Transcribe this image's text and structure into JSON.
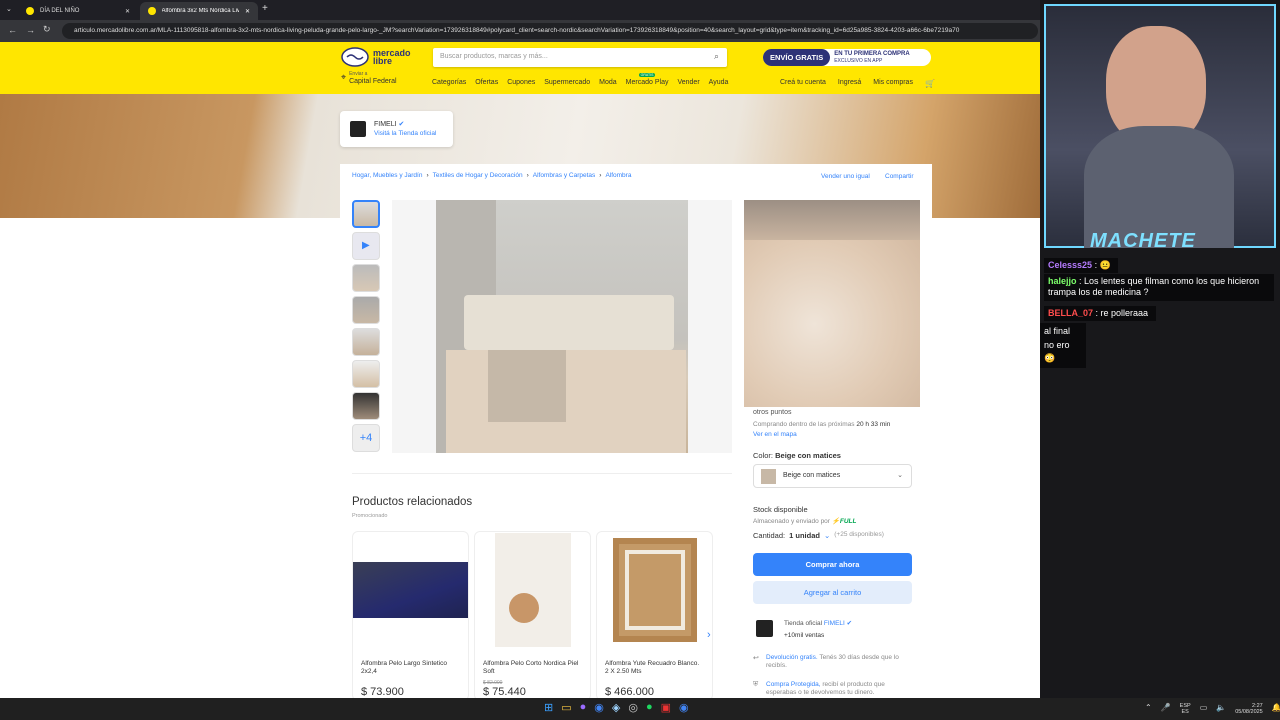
{
  "browser": {
    "tabs": [
      {
        "label": "DÍA DEL NIÑO"
      },
      {
        "label": "Alfombra 3x2 Mts Nórdica Livi"
      }
    ],
    "url": "articulo.mercadolibre.com.ar/MLA-1113095818-alfombra-3x2-mts-nordica-living-peluda-grande-pelo-largo-_JM?searchVariation=173926318849#polycard_client=search-nordic&searchVariation=173926318849&position=40&search_layout=grid&type=item&tracking_id=6d25a985-3824-4203-a66c-6be7219a70"
  },
  "header": {
    "logo_text": "mercado libre",
    "search_placeholder": "Buscar productos, marcas y más...",
    "promo_main": "ENVÍO GRATIS",
    "promo_sub_1": "EN TU PRIMERA COMPRA",
    "promo_sub_2": "EXCLUSIVO EN APP",
    "location_label": "Enviar a",
    "location_value": "Capital Federal",
    "nav": [
      "Categorías",
      "Ofertas",
      "Cupones",
      "Supermercado",
      "Moda",
      "Mercado Play",
      "Vender",
      "Ayuda"
    ],
    "nav_badge": "GRATIS",
    "account": [
      "Creá tu cuenta",
      "Ingresá",
      "Mis compras"
    ]
  },
  "store": {
    "name": "FIMELI",
    "link": "Visitá la Tienda oficial"
  },
  "breadcrumb": [
    "Hogar, Muebles y Jardín",
    "Textiles de Hogar y Decoración",
    "Alfombras y Carpetas",
    "Alfombra"
  ],
  "actions": {
    "sell": "Vender uno igual",
    "share": "Compartir"
  },
  "gallery": {
    "more": "+4"
  },
  "buy": {
    "shipping_tail": "otros puntos",
    "shipping_time": "Comprando dentro de las próximas",
    "shipping_time_bold": "20 h 33 min",
    "map_link": "Ver en el mapa",
    "color_label": "Color:",
    "color_value": "Beige con matices",
    "stock": "Stock disponible",
    "fulfilled": "Almacenado y enviado por",
    "full": "FULL",
    "qty_label": "Cantidad:",
    "qty_value": "1 unidad",
    "qty_available": "(+25 disponibles)",
    "buy_now": "Comprar ahora",
    "add_cart": "Agregar al carrito",
    "seller_prefix": "Tienda oficial",
    "seller_name": "FIMELI",
    "seller_sales": "+10mil ventas",
    "return_link": "Devolución gratis.",
    "return_text": "Tenés 30 días desde que lo recibís.",
    "protect_link": "Compra Protegida,",
    "protect_text": "recibí el producto que esperabas o te devolvemos tu dinero."
  },
  "related": {
    "title": "Productos relacionados",
    "sub": "Promocionado",
    "items": [
      {
        "title": "Alfombra Pelo Largo Sintetico 2x2,4",
        "old": "",
        "price": "$ 73.900"
      },
      {
        "title": "Alfombra Pelo Corto Nordica Piel Soft",
        "old": "$ 82.000",
        "price": "$ 75.440"
      },
      {
        "title": "Alfombra Yute Recuadro Blanco. 2 X 2.50 Mts",
        "old": "",
        "price": "$ 466.000"
      }
    ]
  },
  "stream": {
    "title": "MACHETE",
    "chat": [
      {
        "user": "Celesss25",
        "msg": ":",
        "color": "#b57cff"
      },
      {
        "user": "halejjo",
        "msg": ": Los lentes que filman como los que hicieron trampa los de medicina ?",
        "color": "#7cff6b"
      },
      {
        "user": "BELLA_07",
        "msg": ": re polleraaa",
        "color": "#ff4d4d"
      },
      {
        "user": "",
        "msg": "al final no ero",
        "color": "#fff"
      }
    ]
  },
  "tray": {
    "lang": "ESP",
    "lang_sub": "ES",
    "time": "2:27",
    "date": "05/08/2025"
  }
}
